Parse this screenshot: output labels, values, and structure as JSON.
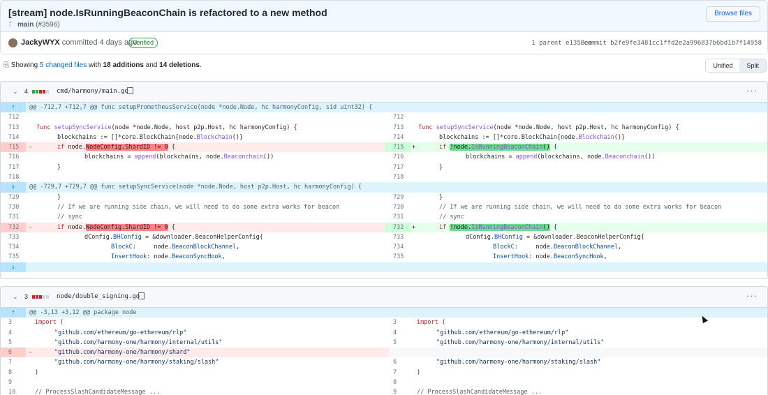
{
  "commit": {
    "title": "[stream] node.IsRunningBeaconChain is refactored to a new method",
    "branch": "main",
    "pr": "(#3596)",
    "browse_label": "Browse files",
    "author": "JackyWYX",
    "committed": "committed 4 days ago",
    "verified": "Verified",
    "parent": "1 parent e135Bee",
    "sha": "commit b2fe9fe3481cc1ffd2e2a996837b6bd1b7f14958"
  },
  "summary": {
    "prefix": "Showing ",
    "changed": "5 changed files",
    "middle": " with ",
    "additions": "18 additions",
    "and": " and ",
    "deletions": "14 deletions",
    "suffix": "."
  },
  "view": {
    "unified": "Unified",
    "split": "Split"
  },
  "files": [
    {
      "count": "4",
      "path": "cmd/harmony/main.go",
      "hunk1": "@@ -712,7 +712,7 @@ func setupPrometheusService(node *node.Node, hc harmonyConfig, sid uint32) {",
      "hunk2": "@@ -729,7 +729,7 @@ func setupSyncService(node *node.Node, host p2p.Host, hc harmonyConfig) {"
    },
    {
      "count": "3",
      "path": "node/double_signing.go",
      "hunk1": "@@ -3,13 +3,12 @@ package node"
    }
  ],
  "icons": {
    "branch": "git-branch-icon",
    "copy": "copy-icon",
    "kebab": "kebab-horizontal-icon",
    "expand": "unfold-icon",
    "chevron": "chevron-down-icon"
  },
  "colors": {
    "accent": "#0969da",
    "deletion": "#ffebe9",
    "addition": "#e6ffec",
    "hunk": "#ddf4ff"
  }
}
